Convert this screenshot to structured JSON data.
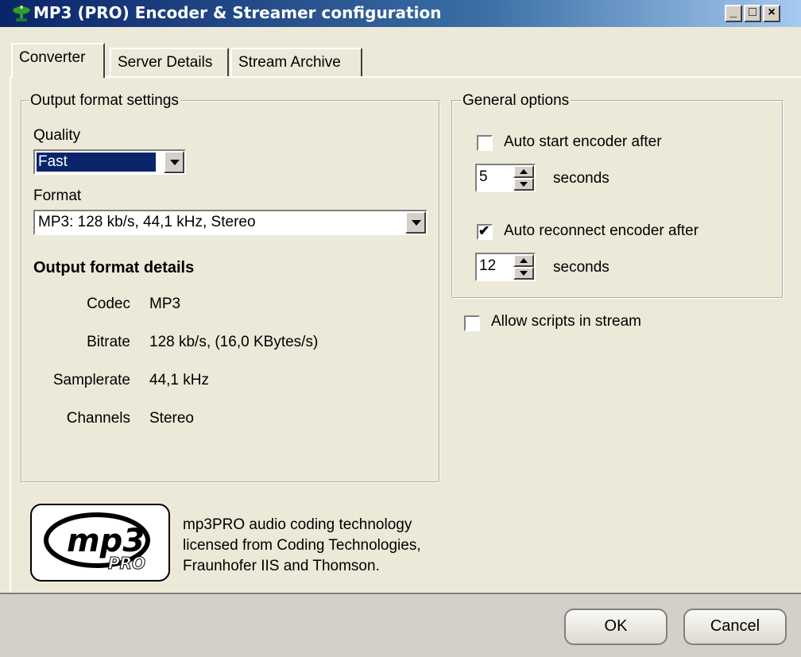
{
  "window": {
    "title": "MP3 (PRO) Encoder & Streamer configuration",
    "controls": {
      "minimize": "_",
      "maximize": "□",
      "close": "×"
    }
  },
  "tabs": [
    {
      "label": "Converter",
      "active": true
    },
    {
      "label": "Server Details",
      "active": false
    },
    {
      "label": "Stream Archive",
      "active": false
    }
  ],
  "output_format": {
    "group_label": "Output format settings",
    "quality_label": "Quality",
    "quality_value": "Fast",
    "format_label": "Format",
    "format_value": "MP3: 128 kb/s, 44,1 kHz, Stereo",
    "details_heading": "Output format details",
    "details": [
      {
        "label": "Codec",
        "value": "MP3"
      },
      {
        "label": "Bitrate",
        "value": "128 kb/s, (16,0 KBytes/s)"
      },
      {
        "label": "Samplerate",
        "value": "44,1 kHz"
      },
      {
        "label": "Channels",
        "value": "Stereo"
      }
    ]
  },
  "general_options": {
    "group_label": "General options",
    "auto_start": {
      "label": "Auto start encoder after",
      "checked": false,
      "value": "5",
      "unit": "seconds"
    },
    "auto_reconnect": {
      "label": "Auto reconnect encoder after",
      "checked": true,
      "value": "12",
      "unit": "seconds"
    },
    "allow_scripts": {
      "label": "Allow scripts in stream",
      "checked": false
    }
  },
  "logo": {
    "text_main": "mp3",
    "text_sub": "PRO",
    "license_lines": [
      "mp3PRO audio coding technology",
      "licensed from Coding Technologies,",
      "Fraunhofer IIS and Thomson."
    ]
  },
  "buttons": {
    "ok": "OK",
    "cancel": "Cancel"
  }
}
